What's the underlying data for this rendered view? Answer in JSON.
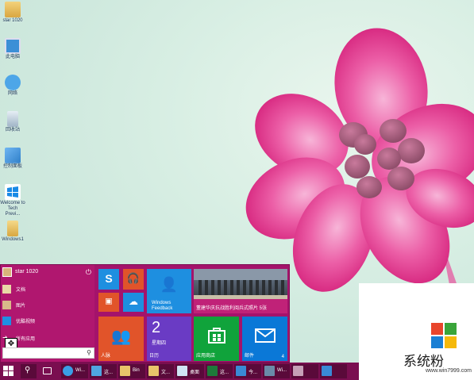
{
  "desktop": {
    "icons": [
      {
        "label": "star 1020",
        "icon": "user-folder-icon"
      },
      {
        "label": "此电脑",
        "icon": "computer-icon"
      },
      {
        "label": "网络",
        "icon": "network-icon"
      },
      {
        "label": "回收站",
        "icon": "recycle-bin-icon"
      },
      {
        "label": "控制面板",
        "icon": "control-panel-icon"
      },
      {
        "label": "Welcome to Tech Previ...",
        "icon": "windows-logo-icon"
      },
      {
        "label": "Windows1",
        "icon": "folder-icon"
      }
    ]
  },
  "start_menu": {
    "user_name": "star 1020",
    "power_icon": "power-icon",
    "items": [
      {
        "label": "文档",
        "icon": "documents-icon"
      },
      {
        "label": "图片",
        "icon": "pictures-icon"
      },
      {
        "label": "优酷视频",
        "icon": "video-icon"
      },
      {
        "label": "所有应用",
        "icon": "all-apps-arrow-icon"
      }
    ],
    "search_placeholder": "",
    "tiles": {
      "skype": {
        "label": ""
      },
      "music": {
        "label": ""
      },
      "video": {
        "label": ""
      },
      "onedrive": {
        "label": ""
      },
      "feedback": {
        "label": "Windows Feedback"
      },
      "news": {
        "label": "董建华庆抗战胜利阅兵式照片 5张"
      },
      "people": {
        "label": "人脉"
      },
      "calendar": {
        "label": "星期四",
        "day": "2",
        "title": "日历"
      },
      "store": {
        "label": "应用商店"
      },
      "mail": {
        "label": "邮件",
        "count": "4"
      }
    }
  },
  "taskbar": {
    "items": [
      {
        "label": "",
        "icon": "start-windows-icon"
      },
      {
        "label": "",
        "icon": "search-icon"
      },
      {
        "label": "",
        "icon": "task-view-icon"
      },
      {
        "label": "Wi...",
        "icon": "ie-icon"
      },
      {
        "label": "这...",
        "icon": "this-pc-icon"
      },
      {
        "label": "Bin",
        "icon": "folder-icon"
      },
      {
        "label": "文...",
        "icon": "folder-icon"
      },
      {
        "label": "桌面",
        "icon": "desktop-icon"
      },
      {
        "label": "这...",
        "icon": "excel-icon"
      },
      {
        "label": "今...",
        "icon": "app-icon"
      },
      {
        "label": "Wi...",
        "icon": "app-icon"
      }
    ]
  },
  "watermark": {
    "text": "系统粉",
    "url": "www.win7999.com"
  },
  "colors": {
    "start_bg": "#a4136b",
    "taskbar_bg": "#7a0e50",
    "tile_blue": "#1e8fe0",
    "tile_orange": "#e1542a",
    "tile_purple": "#6a3bc4",
    "tile_green": "#10a33b",
    "tile_mail": "#0a78d7"
  }
}
